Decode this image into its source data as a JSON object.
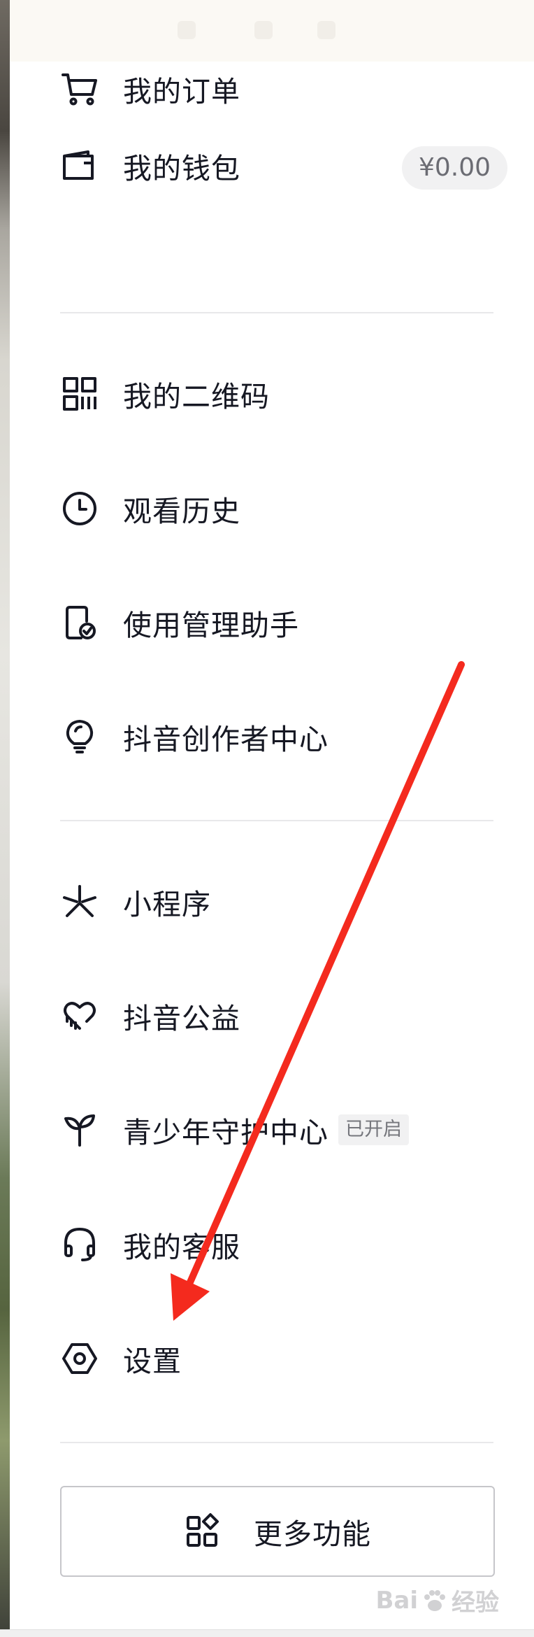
{
  "menu": {
    "orders": {
      "label": "我的订单",
      "icon": "cart-icon"
    },
    "wallet": {
      "label": "我的钱包",
      "icon": "wallet-icon",
      "balance": "¥0.00"
    },
    "qrcode": {
      "label": "我的二维码",
      "icon": "qrcode-icon"
    },
    "history": {
      "label": "观看历史",
      "icon": "clock-icon"
    },
    "usage_assistant": {
      "label": "使用管理助手",
      "icon": "phone-check-icon"
    },
    "creator_center": {
      "label": "抖音创作者中心",
      "icon": "lightbulb-icon"
    },
    "mini_programs": {
      "label": "小程序",
      "icon": "mini-program-icon"
    },
    "charity": {
      "label": "抖音公益",
      "icon": "heart-icon"
    },
    "teen_mode": {
      "label": "青少年守护中心",
      "icon": "sprout-icon",
      "badge": "已开启"
    },
    "customer_service": {
      "label": "我的客服",
      "icon": "headset-icon"
    },
    "settings": {
      "label": "设置",
      "icon": "hexagon-settings-icon"
    }
  },
  "more_features": {
    "label": "更多功能",
    "icon": "grid-shapes-icon"
  },
  "annotation": {
    "arrow_color": "#f42a1e"
  },
  "watermark": {
    "text_prefix": "Bai",
    "text_suffix": "经验"
  },
  "colors": {
    "text": "#161823",
    "divider": "#e8e8ea",
    "pill_bg": "#f1f1f2"
  }
}
